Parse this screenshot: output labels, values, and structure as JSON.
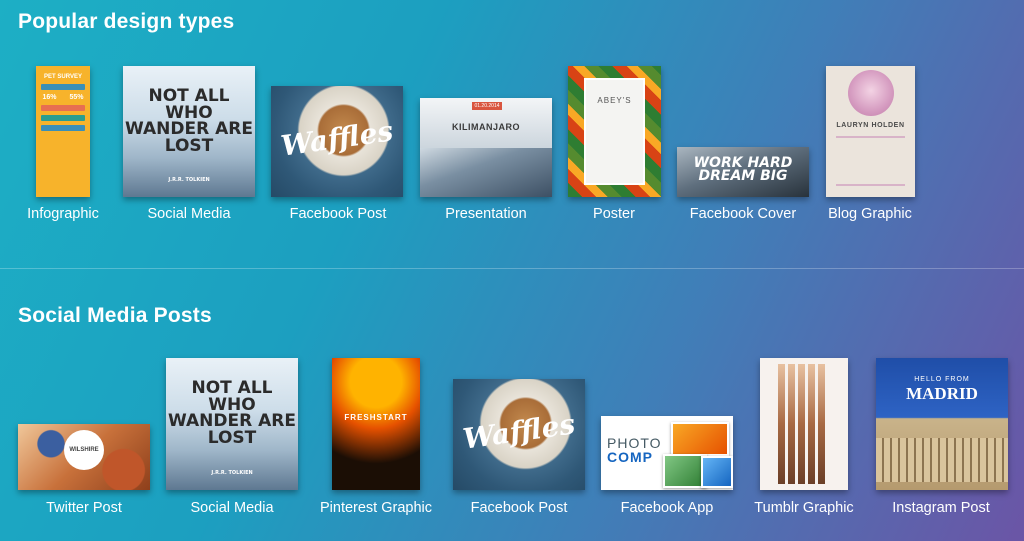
{
  "sections": [
    {
      "title": "Popular design types",
      "items": [
        {
          "label": "Infographic",
          "thumb_text": "PET SURVEY",
          "stats": [
            "16%",
            "55%"
          ]
        },
        {
          "label": "Social Media",
          "thumb_text": "NOT ALL WHO WANDER ARE LOST",
          "thumb_sub": "J.R.R. TOLKIEN"
        },
        {
          "label": "Facebook Post",
          "thumb_text": "Waffles"
        },
        {
          "label": "Presentation",
          "thumb_text": "KILIMANJARO",
          "thumb_tag": "01.20.2014"
        },
        {
          "label": "Poster",
          "thumb_text": "ABEY'S"
        },
        {
          "label": "Facebook Cover",
          "thumb_text": "WORK HARD DREAM BIG"
        },
        {
          "label": "Blog Graphic",
          "thumb_text": "LAURYN HOLDEN"
        }
      ]
    },
    {
      "title": "Social Media Posts",
      "items": [
        {
          "label": "Twitter Post",
          "thumb_text": "WILSHIRE"
        },
        {
          "label": "Social Media",
          "thumb_text": "NOT ALL WHO WANDER ARE LOST",
          "thumb_sub": "J.R.R. TOLKIEN"
        },
        {
          "label": "Pinterest Graphic",
          "thumb_text": "FRESHSTART"
        },
        {
          "label": "Facebook Post",
          "thumb_text": "Waffles"
        },
        {
          "label": "Facebook App",
          "thumb_text_a": "PHOTO",
          "thumb_text_b": "COMP"
        },
        {
          "label": "Tumblr Graphic"
        },
        {
          "label": "Instagram Post",
          "thumb_text_a": "HELLO FROM",
          "thumb_text_b": "MADRID"
        }
      ]
    }
  ]
}
